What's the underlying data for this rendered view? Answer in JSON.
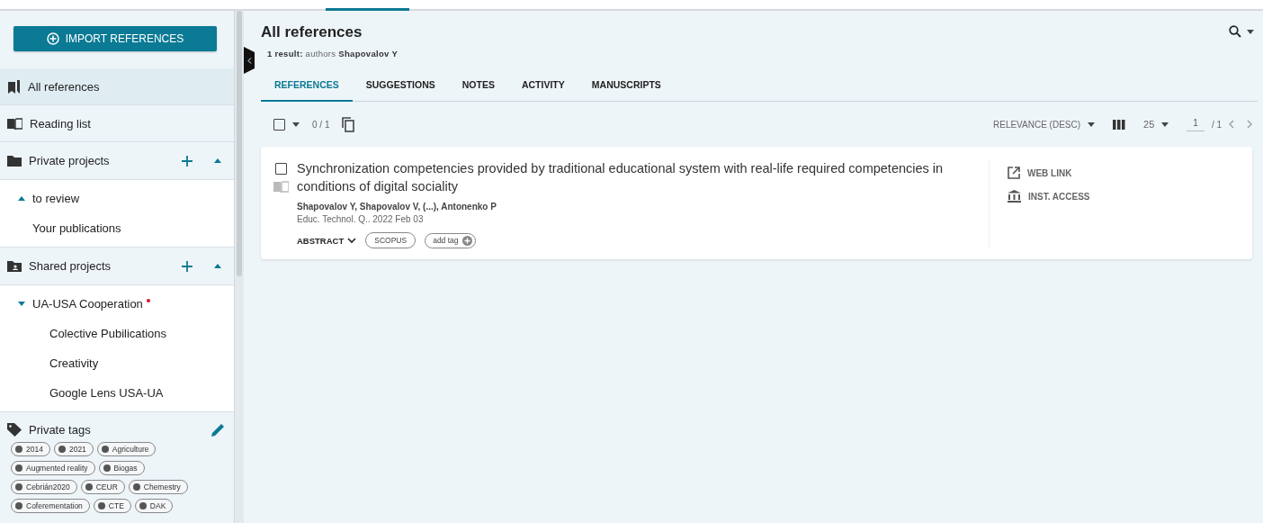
{
  "sidebar": {
    "import_button": "IMPORT REFERENCES",
    "nav": [
      {
        "kind": "references",
        "label": "All references",
        "selected": true
      },
      {
        "kind": "reading",
        "label": "Reading list",
        "selected": false
      }
    ],
    "sections": [
      {
        "kind": "private",
        "title": "Private projects",
        "expanded": true,
        "items": [
          {
            "label": "to review",
            "expanded": false,
            "unread": false
          },
          {
            "label": "Your publications",
            "unread": false
          }
        ]
      },
      {
        "kind": "shared",
        "title": "Shared projects",
        "expanded": true,
        "items": [
          {
            "label": "UA-USA Cooperation",
            "expanded": true,
            "unread": true,
            "children": [
              {
                "label": "Colective Pubilications"
              },
              {
                "label": "Creativity"
              },
              {
                "label": "Google Lens USA-UA"
              }
            ]
          }
        ]
      }
    ],
    "tags_title": "Private tags",
    "tags": [
      {
        "label": "2014"
      },
      {
        "label": "2021"
      },
      {
        "label": "Agriculture"
      },
      {
        "label": "Augmented reality"
      },
      {
        "label": "Biogas"
      },
      {
        "label": "Cebrián2020"
      },
      {
        "label": "CEUR"
      },
      {
        "label": "Chemestry"
      },
      {
        "label": "Coferementation"
      },
      {
        "label": "CTE"
      },
      {
        "label": "DAK"
      }
    ]
  },
  "main": {
    "title": "All references",
    "summary": "**1 result:** authors **Shapovalov Y**",
    "tabs": [
      {
        "label": "REFERENCES",
        "selected": true
      },
      {
        "label": "SUGGESTIONS",
        "selected": false
      },
      {
        "label": "NOTES",
        "selected": false
      },
      {
        "label": "ACTIVITY",
        "selected": false
      },
      {
        "label": "MANUSCRIPTS",
        "selected": false
      }
    ],
    "toolbar": {
      "select_all_checked": false,
      "selection_count": "0 / 1",
      "sort": "RELEVANCE (DESC)",
      "page_size": "25",
      "page": "1",
      "page_total": "/ 1"
    },
    "references": [
      {
        "checked": false,
        "title": "Synchronization competencies provided by traditional educational system with real-life required competencies in conditions of digital sociality",
        "authors": "Shapovalov Y, Shapovalov V, (...), Antonenko P",
        "source": "Educ. Technol. Q.. 2022 Feb 03",
        "abstract_label": "ABSTRACT",
        "tags": [
          "SCOPUS"
        ],
        "add_tag": "add tag",
        "links": [
          {
            "kind": "web",
            "label": "WEB LINK"
          },
          {
            "kind": "institution",
            "label": "INST. ACCESS"
          }
        ]
      }
    ]
  }
}
